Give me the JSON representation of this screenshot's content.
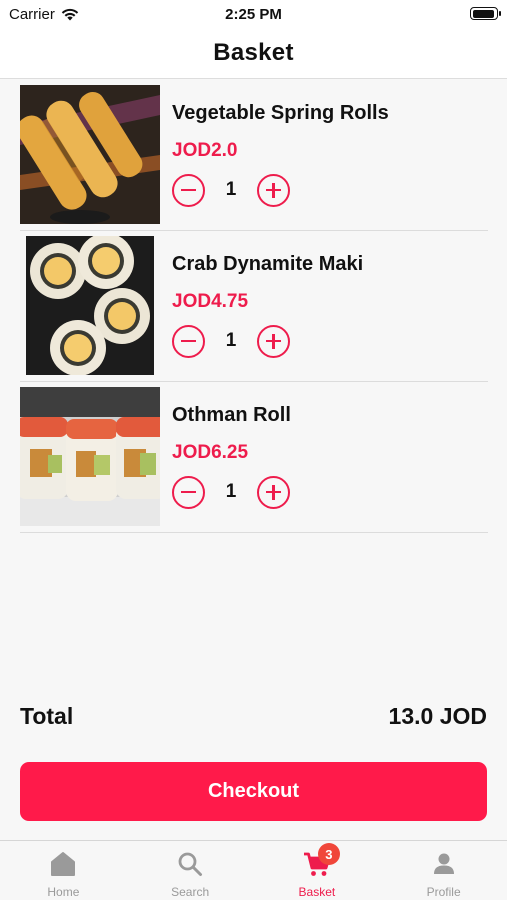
{
  "status_bar": {
    "carrier": "Carrier",
    "time": "2:25 PM"
  },
  "nav": {
    "title": "Basket"
  },
  "items": [
    {
      "name": "Vegetable Spring Rolls",
      "price": "JOD2.0",
      "qty": "1",
      "image": "spring-rolls-photo"
    },
    {
      "name": "Crab Dynamite Maki",
      "price": "JOD4.75",
      "qty": "1",
      "image": "dynamite-maki-photo"
    },
    {
      "name": "Othman Roll",
      "price": "JOD6.25",
      "qty": "1",
      "image": "othman-roll-photo"
    }
  ],
  "summary": {
    "total_label": "Total",
    "total_value": "13.0 JOD"
  },
  "checkout": {
    "label": "Checkout"
  },
  "tabs": [
    {
      "label": "Home",
      "icon": "home-icon"
    },
    {
      "label": "Search",
      "icon": "search-icon"
    },
    {
      "label": "Basket",
      "icon": "cart-icon",
      "badge": "3",
      "active": true
    },
    {
      "label": "Profile",
      "icon": "profile-icon"
    }
  ],
  "colors": {
    "accent": "#ee1c4c",
    "checkout_bg": "#ff1a4a",
    "badge_bg": "#f0463a",
    "inactive_tab": "#9a9a9a"
  }
}
